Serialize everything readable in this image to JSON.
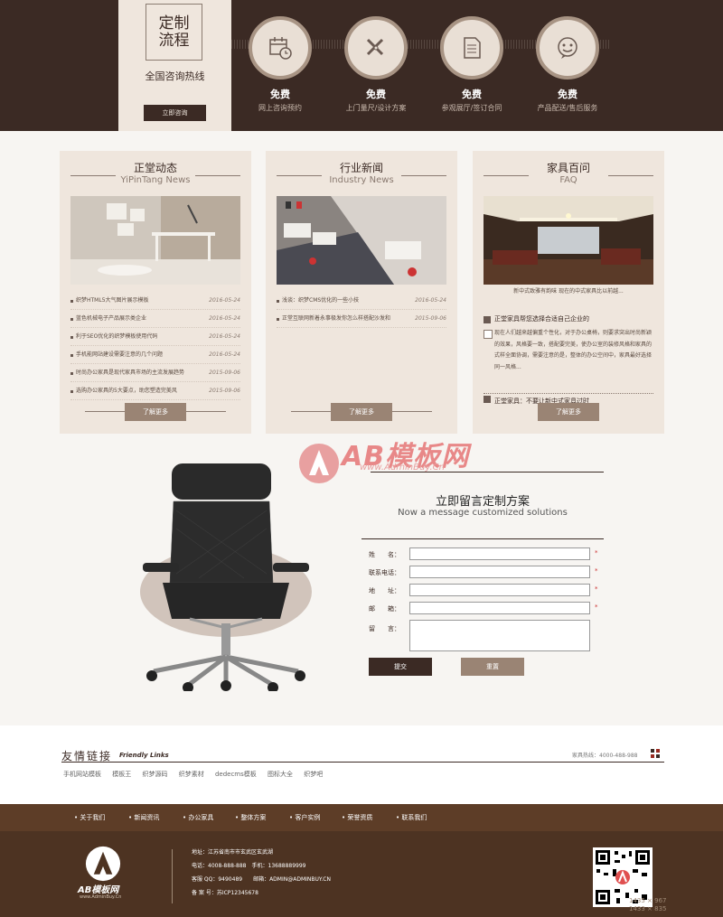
{
  "header": {
    "custom_title_1": "定制",
    "custom_title_2": "流程",
    "hotline_label": "全国咨询热线",
    "consult_button": "立即咨询",
    "steps": [
      {
        "free": "免费",
        "desc": "网上咨询预约",
        "icon": "calendar-clock-icon"
      },
      {
        "free": "免费",
        "desc": "上门量尺/设计方案",
        "icon": "ruler-pencil-icon"
      },
      {
        "free": "免费",
        "desc": "参观展厅/签订合同",
        "icon": "document-icon"
      },
      {
        "free": "免费",
        "desc": "产品配送/售后服务",
        "icon": "smiley-icon"
      }
    ]
  },
  "news_panels": [
    {
      "title": "正堂动态",
      "subtitle": "YiPinTang News",
      "items": [
        {
          "text": "织梦HTML5大气图片展示模板",
          "date": "2016-05-24"
        },
        {
          "text": "蓝色机械电子产品展示类企业",
          "date": "2016-05-24"
        },
        {
          "text": "利于SEO优化的织梦模板使用代码",
          "date": "2016-05-24"
        },
        {
          "text": "手机能网站建设需要注意的几个问题",
          "date": "2016-05-24"
        },
        {
          "text": "时尚办公家具是现代家具市场的主流发展趋势",
          "date": "2015-09-06"
        },
        {
          "text": "选购办公家具的5大要点，助您塑造完美风",
          "date": "2015-09-06"
        }
      ],
      "more": "了解更多"
    },
    {
      "title": "行业新闻",
      "subtitle": "Industry News",
      "items": [
        {
          "text": "浅谈：织梦CMS优化的一些小技",
          "date": "2016-05-24"
        },
        {
          "text": "正堂互联网新着永事极发你怎么样搭配沙发和",
          "date": "2015-09-06"
        }
      ],
      "more": "了解更多"
    },
    {
      "title": "家具百问",
      "subtitle": "FAQ",
      "image_caption": "新中式致雅有韵味 现在的中式家具比以前越...",
      "q1": "正堂家具帮您选择合适自己企业的",
      "a1": "现在人们越来越偏重个性化，对于办公桌椅，则要求突出时尚新颖的效果，风格要一致，搭配要完美，使办公室的装修风格和家具的式样全面协调，需要注意的是，整体的办公空间中，家具最好选择同一风格...",
      "q2": "正堂家具：不要让新中式家具过时",
      "more": "了解更多"
    }
  ],
  "watermark": {
    "brand": "AB模板网",
    "url": "www.AdminBuy.Cn"
  },
  "form": {
    "title": "立即留言定制方案",
    "subtitle": "Now a message customized solutions",
    "fields": [
      {
        "label": "姓　　名：",
        "required": "*"
      },
      {
        "label": "联系电话：",
        "required": "*"
      },
      {
        "label": "地　　址：",
        "required": "*"
      },
      {
        "label": "邮　　箱：",
        "required": "*"
      }
    ],
    "message_label": "留　　言：",
    "submit": "提交",
    "reset": "重置"
  },
  "friendly_links": {
    "title": "友情链接",
    "title_en": "Friendly Links",
    "phone": "家具热线：4000-488-988",
    "links": [
      "手机网站模板",
      "模板王",
      "织梦源码",
      "织梦素材",
      "dedecms模板",
      "图标大全",
      "织梦吧"
    ]
  },
  "footer": {
    "nav": [
      "关于我们",
      "新闻资讯",
      "办公家具",
      "整体方案",
      "客户实例",
      "荣誉资质",
      "联系我们"
    ],
    "logo_text": "AB模板网",
    "logo_sub": "www.AdminBuy.Cn",
    "address": "地址：江苏省南市市玄武区玄武湖",
    "phone": "电话：4008-888-888　手机：13688889999",
    "qq": "客服 QQ：9490489　　邮箱：ADMIN@ADMINBUY.CN",
    "icp": "备 案 号：苏ICP12345678",
    "size_line1": "1435 × 967",
    "size_line2": "1433 × 835"
  },
  "colors": {
    "dark_brown": "#3b2a24",
    "beige": "#efe6dd",
    "accent": "#9a8474",
    "footer": "#4d3322"
  }
}
